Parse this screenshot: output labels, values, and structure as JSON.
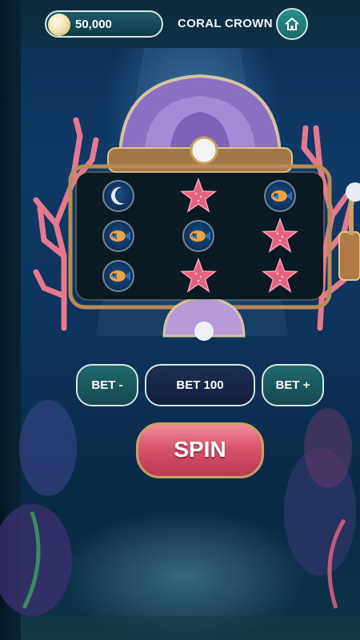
{
  "header": {
    "balance": "50,000",
    "title": "CORAL CROWN",
    "coin_icon": "pearl-coin-icon",
    "home_icon": "home-icon"
  },
  "reels": {
    "rows": [
      [
        "moon",
        "starfish",
        "fish"
      ],
      [
        "fish",
        "fish",
        "starfish"
      ],
      [
        "fish",
        "starfish",
        "starfish"
      ]
    ]
  },
  "controls": {
    "bet_minus_label": "BET -",
    "bet_display": "BET 100",
    "bet_plus_label": "BET +",
    "spin_label": "SPIN"
  },
  "colors": {
    "accent_teal": "#1f6a6c",
    "spin_pink": "#d9546c",
    "gold_trim": "#c9a062",
    "starfish": "#e8607e"
  }
}
